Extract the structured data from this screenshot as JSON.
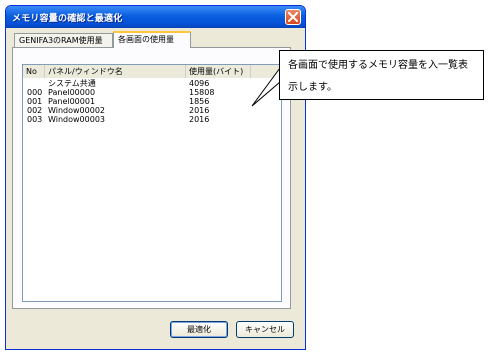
{
  "dialog": {
    "title": "メモリ容量の確認と最適化",
    "close_icon": "close-icon"
  },
  "tabs": [
    {
      "label": "GENIFA3のRAM使用量",
      "active": false
    },
    {
      "label": "各画面の使用量",
      "active": true
    }
  ],
  "list": {
    "columns": [
      "No",
      "パネル/ウィンドウ名",
      "使用量(バイト)"
    ],
    "rows": [
      {
        "no": "",
        "name": "システム共通",
        "size": "4096"
      },
      {
        "no": "000",
        "name": "Panel00000",
        "size": "15808"
      },
      {
        "no": "001",
        "name": "Panel00001",
        "size": "1856"
      },
      {
        "no": "002",
        "name": "Window00002",
        "size": "2016"
      },
      {
        "no": "003",
        "name": "Window00003",
        "size": "2016"
      }
    ]
  },
  "buttons": {
    "optimize": "最適化",
    "cancel": "キャンセル"
  },
  "callout": {
    "text": "各画面で使用するメモリ容量を入一覧表示します。"
  }
}
